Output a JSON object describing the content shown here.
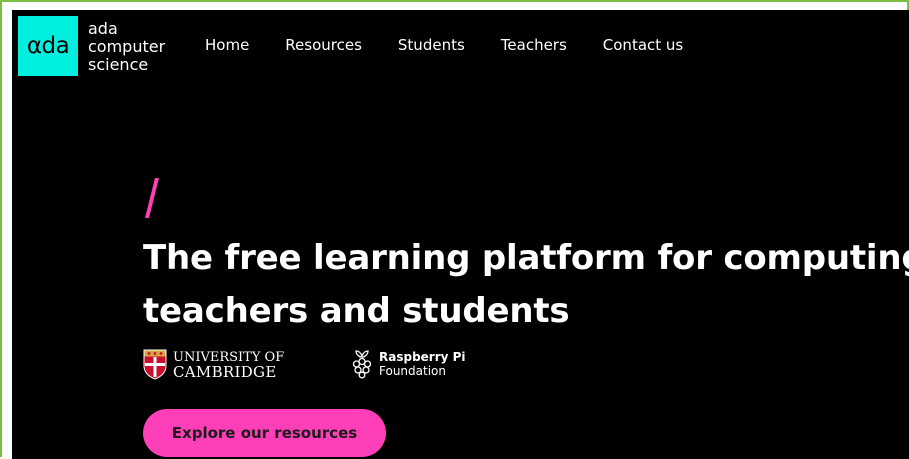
{
  "brand": {
    "logo_mark": "αda",
    "name_lines": [
      "ada",
      "computer",
      "science"
    ],
    "logo_color": "#00f0df"
  },
  "nav": {
    "items": [
      "Home",
      "Resources",
      "Students",
      "Teachers",
      "Contact us"
    ]
  },
  "hero": {
    "accent_color": "#ff3fb7",
    "headline_lines": [
      "The free learning platform for computing",
      "teachers and students"
    ]
  },
  "partners": {
    "cambridge": {
      "line1": "UNIVERSITY OF",
      "line2": "CAMBRIDGE",
      "icon": "cambridge-crest-icon"
    },
    "raspberry_pi": {
      "line1": "Raspberry Pi",
      "line2": "Foundation",
      "icon": "raspberry-pi-icon"
    }
  },
  "cta": {
    "label": "Explore our resources"
  }
}
